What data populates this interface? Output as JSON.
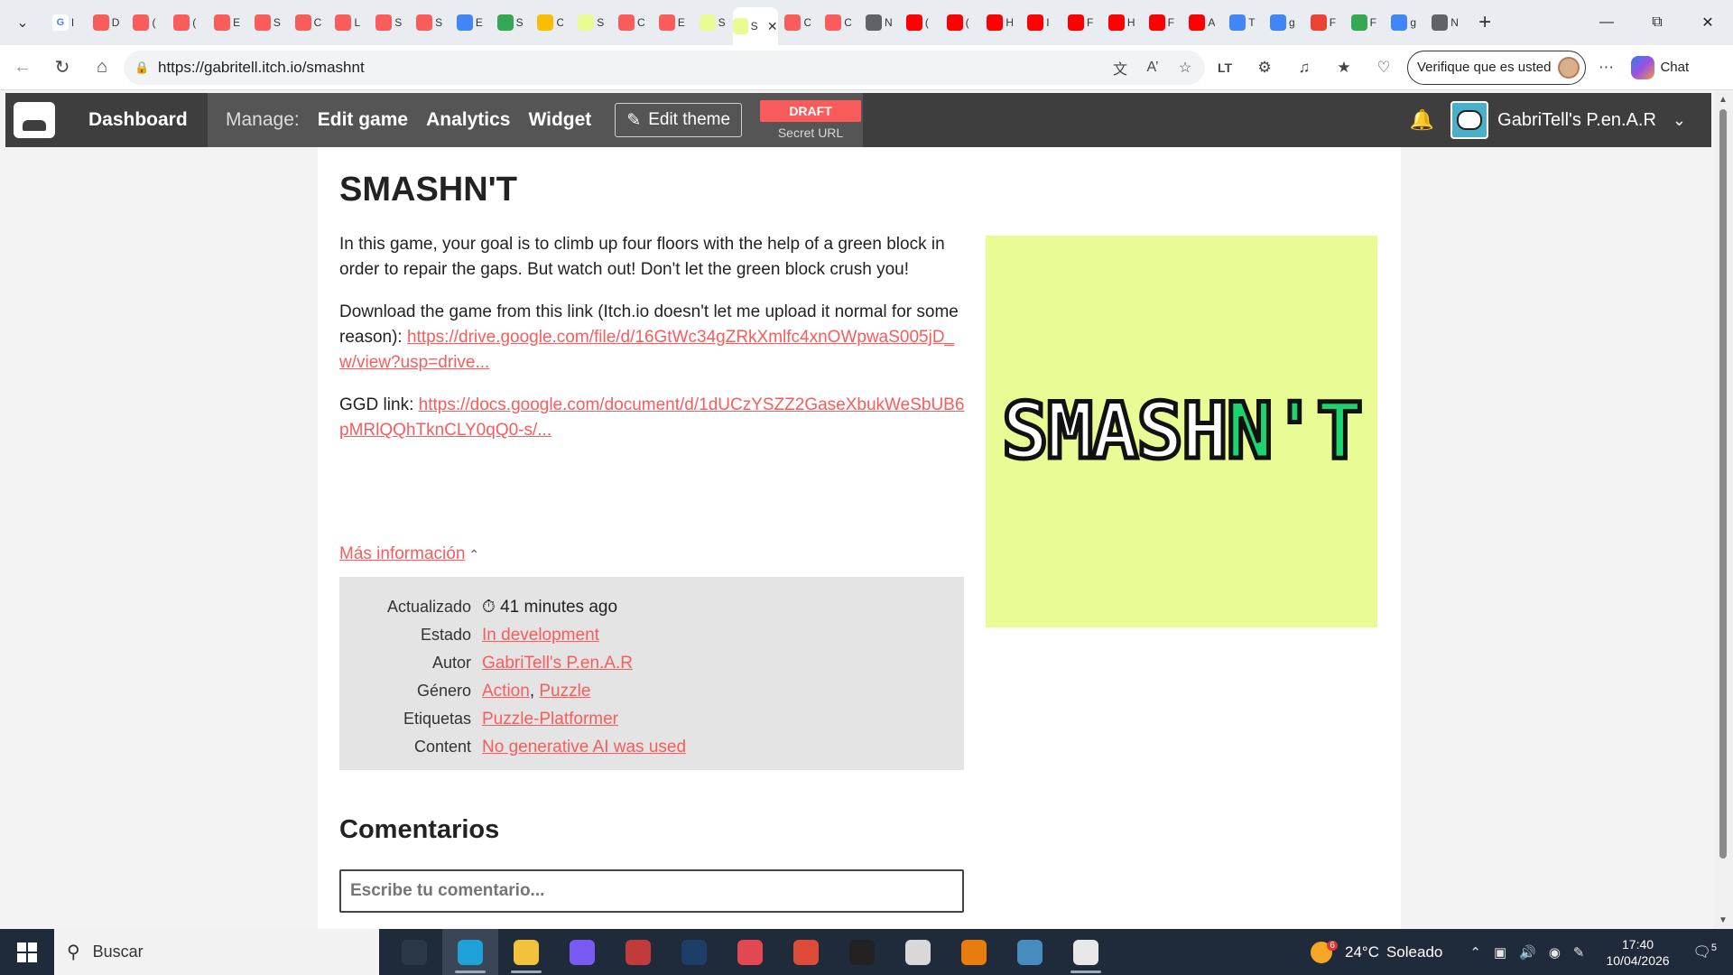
{
  "browser": {
    "tabs": [
      {
        "icon": "google-icon",
        "letter": "I",
        "color": "#ffffff",
        "glyph": "G",
        "glyph_color": "#4285f4"
      },
      {
        "icon": "itch-icon",
        "letter": "D",
        "color": "#fa5c5c"
      },
      {
        "icon": "itch-icon",
        "letter": "(",
        "color": "#fa5c5c"
      },
      {
        "icon": "itch-icon",
        "letter": "(",
        "color": "#fa5c5c"
      },
      {
        "icon": "itch-icon",
        "letter": "E",
        "color": "#fa5c5c"
      },
      {
        "icon": "itch-icon",
        "letter": "S",
        "color": "#fa5c5c"
      },
      {
        "icon": "itch-icon",
        "letter": "C",
        "color": "#fa5c5c"
      },
      {
        "icon": "itch-icon",
        "letter": "L",
        "color": "#fa5c5c"
      },
      {
        "icon": "itch-icon",
        "letter": "S",
        "color": "#fa5c5c"
      },
      {
        "icon": "itch-icon",
        "letter": "S",
        "color": "#fa5c5c"
      },
      {
        "icon": "docs-icon",
        "letter": "E",
        "color": "#4285f4"
      },
      {
        "icon": "drive-icon",
        "letter": "S",
        "color": "#34a853"
      },
      {
        "icon": "drive-icon",
        "letter": "C",
        "color": "#fbbc04"
      },
      {
        "icon": "smashnt-icon",
        "letter": "S",
        "color": "#e8fb95"
      },
      {
        "icon": "itch-icon",
        "letter": "C",
        "color": "#fa5c5c"
      },
      {
        "icon": "itch-icon",
        "letter": "E",
        "color": "#fa5c5c"
      },
      {
        "icon": "smashnt-icon",
        "letter": "S",
        "color": "#e8fb95"
      },
      {
        "icon": "smashnt-icon",
        "letter": "S",
        "color": "#e8fb95",
        "active": true
      },
      {
        "icon": "itch-icon",
        "letter": "C",
        "color": "#fa5c5c"
      },
      {
        "icon": "itch-icon",
        "letter": "C",
        "color": "#fa5c5c"
      },
      {
        "icon": "window-icon",
        "letter": "N",
        "color": "#5f6368"
      },
      {
        "icon": "youtube-icon",
        "letter": "(",
        "color": "#ff0000"
      },
      {
        "icon": "youtube-icon",
        "letter": "(",
        "color": "#ff0000"
      },
      {
        "icon": "youtube-icon",
        "letter": "H",
        "color": "#ff0000"
      },
      {
        "icon": "youtube-icon",
        "letter": "I",
        "color": "#ff0000"
      },
      {
        "icon": "youtube-icon",
        "letter": "F",
        "color": "#ff0000"
      },
      {
        "icon": "youtube-icon",
        "letter": "H",
        "color": "#ff0000"
      },
      {
        "icon": "youtube-icon",
        "letter": "F",
        "color": "#ff0000"
      },
      {
        "icon": "youtube-icon",
        "letter": "A",
        "color": "#ff0000"
      },
      {
        "icon": "translate-icon",
        "letter": "T",
        "color": "#4285f4"
      },
      {
        "icon": "search-icon",
        "letter": "g",
        "color": "#4285f4"
      },
      {
        "icon": "gmail-icon",
        "letter": "F",
        "color": "#ea4335"
      },
      {
        "icon": "drive-icon",
        "letter": "F",
        "color": "#34a853"
      },
      {
        "icon": "search-icon",
        "letter": "g",
        "color": "#4285f4"
      },
      {
        "icon": "window-icon",
        "letter": "N",
        "color": "#5f6368"
      }
    ],
    "url": "https://gabritell.itch.io/smashnt",
    "verify_label": "Verifique que es usted",
    "chat_label": "Chat"
  },
  "itch_header": {
    "dashboard": "Dashboard",
    "manage_label": "Manage:",
    "edit_game": "Edit game",
    "analytics": "Analytics",
    "widget": "Widget",
    "edit_theme": "Edit theme",
    "draft": "DRAFT",
    "secret_url": "Secret URL",
    "user_name": "GabriTell's P.en.A.R"
  },
  "game": {
    "title": "SMASHN'T",
    "paragraph1": "In this game, your goal is to climb up four floors with the help of a green block in order to repair the gaps. But watch out! Don't let the green block crush you!",
    "paragraph2_text": "Download the game from this link (Itch.io doesn't let me upload it normal for some reason): ",
    "paragraph2_link": "https://drive.google.com/file/d/16GtWc34gZRkXmlfc4xnOWpwaS005jD_w/view?usp=drive...",
    "paragraph3_text": "GGD link: ",
    "paragraph3_link": "https://docs.google.com/document/d/1dUCzYSZZ2GaseXbukWeSbUB6pMRlQQhTknCLY0qQ0-s/...",
    "cover_logo_white": "SMASH",
    "cover_logo_green": "N'T",
    "more_info": "Más información",
    "info": {
      "updated_label": "Actualizado",
      "updated_value": "41 minutes ago",
      "status_label": "Estado",
      "status_value": "In development",
      "author_label": "Autor",
      "author_value": "GabriTell's P.en.A.R",
      "genre_label": "Género",
      "genre_1": "Action",
      "genre_2": "Puzzle",
      "tags_label": "Etiquetas",
      "tags_value": "Puzzle-Platformer",
      "content_label": "Content",
      "content_value": "No generative AI was used"
    },
    "comments_title": "Comentarios",
    "comment_placeholder": "Escribe tu comentario..."
  },
  "taskbar": {
    "search_placeholder": "Buscar",
    "weather_temp": "24°C",
    "weather_text": "Soleado",
    "weather_badge": "6",
    "time": "17:40",
    "date": "10/04/2026",
    "notif_count": "5",
    "apps": [
      {
        "name": "task-view-icon",
        "color": "#2b3848"
      },
      {
        "name": "edge-icon",
        "color": "#1fa2d8",
        "active": true
      },
      {
        "name": "file-explorer-icon",
        "color": "#f3c23b",
        "running": true
      },
      {
        "name": "microsoft365-icon",
        "color": "#7a5af5"
      },
      {
        "name": "aseprite-icon",
        "color": "#c23b3b"
      },
      {
        "name": "steam-icon",
        "color": "#1b3f66"
      },
      {
        "name": "creative-cloud-icon",
        "color": "#e34850"
      },
      {
        "name": "chrome-icon",
        "color": "#dd4b39"
      },
      {
        "name": "unity-icon",
        "color": "#222222"
      },
      {
        "name": "lines-app-icon",
        "color": "#d8d8d8"
      },
      {
        "name": "blender-icon",
        "color": "#e87d0d"
      },
      {
        "name": "godot-icon",
        "color": "#478cbf"
      },
      {
        "name": "twitch-icon",
        "color": "#e8e8e8",
        "running": true
      }
    ]
  }
}
